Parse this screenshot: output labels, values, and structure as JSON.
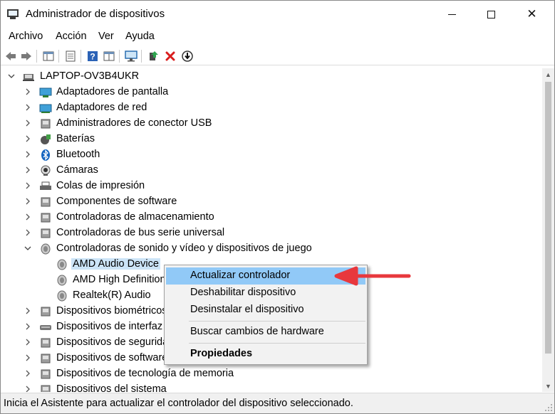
{
  "window": {
    "title": "Administrador de dispositivos",
    "controls": {
      "minimize": "minimize-icon",
      "maximize": "maximize-icon",
      "close": "✕"
    }
  },
  "menubar": [
    "Archivo",
    "Acción",
    "Ver",
    "Ayuda"
  ],
  "toolbar": [
    "back-icon",
    "forward-icon",
    "show-hide-console-tree-icon",
    "properties-icon",
    "help-icon",
    "view-icon",
    "monitor-icon",
    "update-driver-icon",
    "uninstall-icon",
    "download-icon"
  ],
  "tree": {
    "root": "LAPTOP-OV3B4UKR",
    "items": [
      {
        "label": "Adaptadores de pantalla",
        "icon": "display-adapter-icon",
        "expanded": false
      },
      {
        "label": "Adaptadores de red",
        "icon": "network-adapter-icon",
        "expanded": false
      },
      {
        "label": "Administradores de conector USB",
        "icon": "usb-connector-icon",
        "expanded": false
      },
      {
        "label": "Baterías",
        "icon": "battery-icon",
        "expanded": false
      },
      {
        "label": "Bluetooth",
        "icon": "bluetooth-icon",
        "expanded": false
      },
      {
        "label": "Cámaras",
        "icon": "camera-icon",
        "expanded": false
      },
      {
        "label": "Colas de impresión",
        "icon": "printer-icon",
        "expanded": false
      },
      {
        "label": "Componentes de software",
        "icon": "software-component-icon",
        "expanded": false
      },
      {
        "label": "Controladoras de almacenamiento",
        "icon": "storage-controller-icon",
        "expanded": false
      },
      {
        "label": "Controladoras de bus serie universal",
        "icon": "usb-controller-icon",
        "expanded": false
      },
      {
        "label": "Controladoras de sonido y vídeo y dispositivos de juego",
        "icon": "speaker-icon",
        "expanded": true
      },
      {
        "label": "Dispositivos biométricos",
        "icon": "biometric-icon",
        "expanded": false
      },
      {
        "label": "Dispositivos de interfaz de usuario (HID)",
        "icon": "hid-icon",
        "expanded": false
      },
      {
        "label": "Dispositivos de seguridad",
        "icon": "security-device-icon",
        "expanded": false
      },
      {
        "label": "Dispositivos de software",
        "icon": "software-device-icon",
        "expanded": false
      },
      {
        "label": "Dispositivos de tecnología de memoria",
        "icon": "memory-device-icon",
        "expanded": false
      },
      {
        "label": "Dispositivos del sistema",
        "icon": "system-device-icon",
        "expanded": false
      }
    ],
    "sound_children": [
      {
        "label": "AMD Audio Device",
        "icon": "speaker-icon",
        "selected": true
      },
      {
        "label": "AMD High Definition Audio Device",
        "icon": "speaker-icon",
        "selected": false
      },
      {
        "label": "Realtek(R) Audio",
        "icon": "speaker-icon",
        "selected": false
      }
    ]
  },
  "context_menu": {
    "items": [
      {
        "label": "Actualizar controlador",
        "highlighted": true
      },
      {
        "label": "Deshabilitar dispositivo"
      },
      {
        "label": "Desinstalar el dispositivo"
      },
      {
        "label": "Buscar cambios de hardware"
      },
      {
        "label": "Propiedades",
        "bold": true
      }
    ]
  },
  "annotation": {
    "arrow_color": "#e8383d"
  },
  "statusbar": {
    "text": "Inicia el Asistente para actualizar el controlador del dispositivo seleccionado."
  },
  "colors": {
    "selection": "#cce4f7",
    "menu_highlight": "#91c9f7",
    "arrow": "#e8383d"
  }
}
